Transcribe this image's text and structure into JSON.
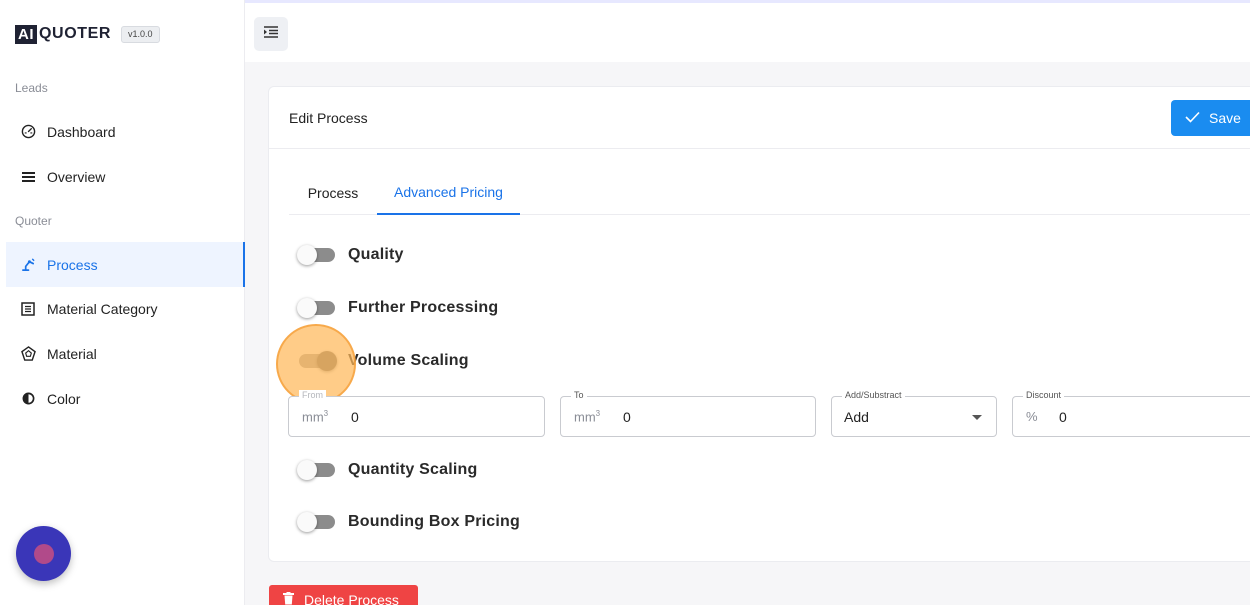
{
  "brand": {
    "ai": "AI",
    "name": "QUOTER",
    "version": "v1.0.0"
  },
  "sidebar": {
    "sections": [
      {
        "label": "Leads"
      },
      {
        "label": "Quoter"
      }
    ],
    "items": [
      {
        "label": "Dashboard",
        "icon": "gauge-icon"
      },
      {
        "label": "Overview",
        "icon": "list-icon"
      },
      {
        "label": "Process",
        "icon": "robot-arm-icon",
        "active": true
      },
      {
        "label": "Material Category",
        "icon": "grid-box-icon"
      },
      {
        "label": "Material",
        "icon": "polyhedron-icon"
      },
      {
        "label": "Color",
        "icon": "contrast-icon"
      }
    ]
  },
  "card": {
    "title": "Edit Process",
    "save_label": "Save"
  },
  "tabs": [
    {
      "label": "Process"
    },
    {
      "label": "Advanced Pricing",
      "active": true
    }
  ],
  "toggles": [
    {
      "label": "Quality",
      "on": false
    },
    {
      "label": "Further Processing",
      "on": false
    },
    {
      "label": "Volume Scaling",
      "on": true
    },
    {
      "label": "Quantity Scaling",
      "on": false
    },
    {
      "label": "Bounding Box Pricing",
      "on": false
    }
  ],
  "volume_fields": {
    "from": {
      "label": "From",
      "unit": "mm",
      "unit_sup": "3",
      "value": "0"
    },
    "to": {
      "label": "To",
      "unit": "mm",
      "unit_sup": "3",
      "value": "0"
    },
    "add_subtract": {
      "label": "Add/Substract",
      "value": "Add"
    },
    "discount": {
      "label": "Discount",
      "unit": "%",
      "value": "0"
    }
  },
  "delete_label": "Delete Process",
  "colors": {
    "accent": "#1a73e8",
    "save": "#1a8cf0",
    "danger": "#ef4444",
    "chat": "#3a36b8"
  }
}
